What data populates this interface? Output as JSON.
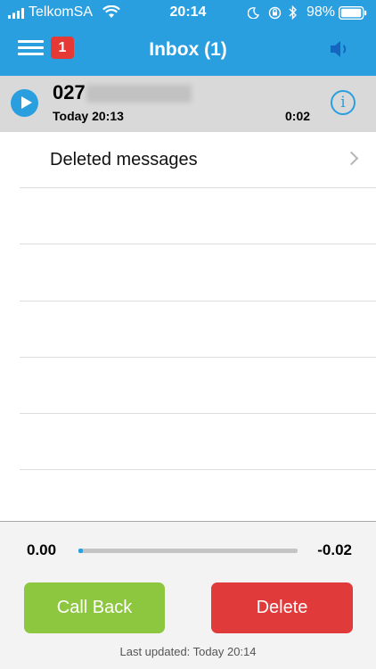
{
  "status_bar": {
    "carrier": "TelkomSA",
    "time": "20:14",
    "battery": "98%"
  },
  "nav": {
    "title": "Inbox (1)",
    "badge": "1",
    "menu_icon": "hamburger-icon",
    "speaker_icon": "speaker-icon"
  },
  "message": {
    "number_visible": "027",
    "date": "Today 20:13",
    "duration": "0:02",
    "info_glyph": "i"
  },
  "deleted": {
    "label": "Deleted messages"
  },
  "player": {
    "time_start": "0.00",
    "time_end": "-0.02",
    "progress": 0.0
  },
  "actions": {
    "call_back": "Call Back",
    "delete": "Delete"
  },
  "footer": {
    "last_updated": "Last updated: Today 20:14"
  },
  "colors": {
    "accent": "#2a9fe0",
    "call_back": "#8dc63f",
    "delete": "#e03a3a",
    "badge": "#e53935"
  }
}
